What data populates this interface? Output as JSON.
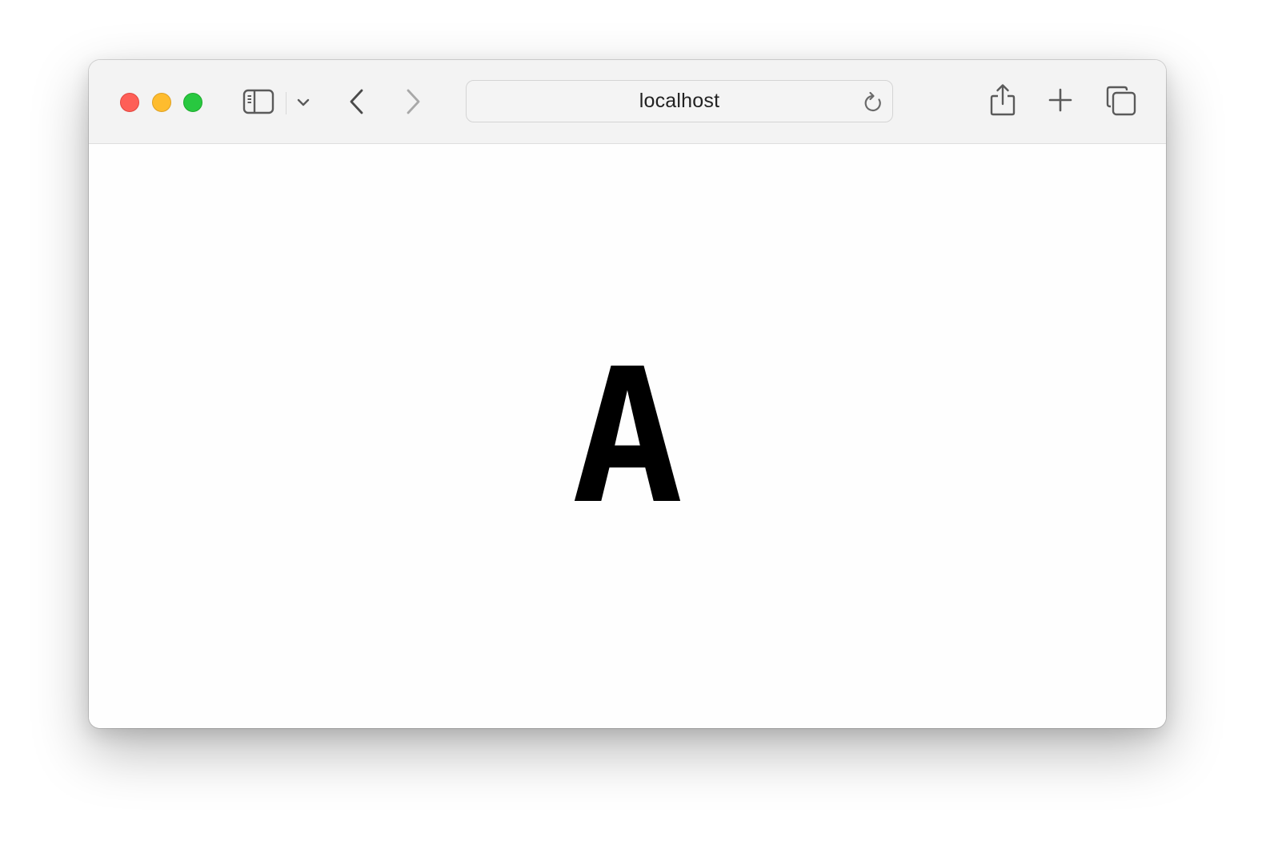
{
  "browser": {
    "window_controls": {
      "close": "close",
      "minimize": "minimize",
      "maximize": "maximize"
    },
    "toolbar": {
      "sidebar_icon": "sidebar-icon",
      "tab_group_chevron_icon": "chevron-down-icon",
      "back_icon": "chevron-left-icon",
      "forward_icon": "chevron-right-icon",
      "share_icon": "share-icon",
      "new_tab_icon": "plus-icon",
      "tab_overview_icon": "tabs-overview-icon"
    },
    "address_bar": {
      "url": "localhost",
      "reload_icon": "reload-icon"
    }
  },
  "page": {
    "content_text": "A"
  },
  "colors": {
    "close": "#fe5f57",
    "minimize": "#febc2e",
    "maximize": "#28c840",
    "toolbar_bg": "#f3f3f3",
    "content_text": "#000000"
  }
}
